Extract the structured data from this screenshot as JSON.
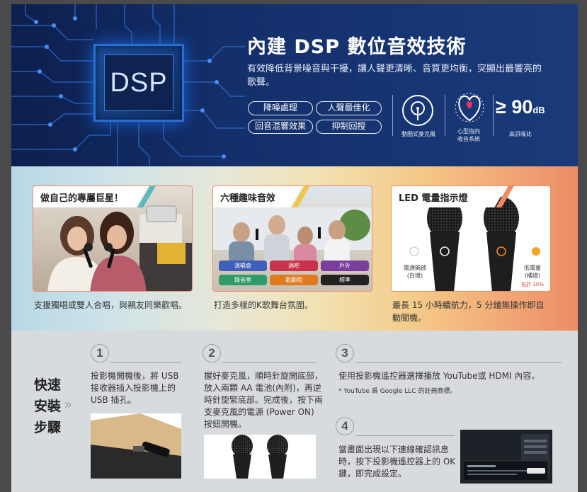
{
  "hero": {
    "chip_text": "DSP",
    "title": "內建 DSP 數位音效技術",
    "desc": "有效降低背景噪音與干擾，讓人聲更清晰、音質更均衡，突顯出最響亮的歌聲。",
    "pills": [
      "降噪處理",
      "人聲最佳化",
      "回音混響效果",
      "抑制回授"
    ],
    "features": [
      {
        "icon": "dynamic-mic-icon",
        "label": "動圈式麥克風"
      },
      {
        "icon": "cardioid-pattern-icon",
        "label": "心型指向\n收音系統"
      },
      {
        "value": "≥ 90",
        "unit": "dB",
        "label": "高訊噪比"
      }
    ]
  },
  "strip": {
    "cards": [
      {
        "title": "做自己的專屬巨星！",
        "caption": "支援獨唱或雙人合唱，與親友同樂歡唱。"
      },
      {
        "title": "六種趣味音效",
        "caption": "打造多樣的K歌舞台氛圍。",
        "effects": [
          {
            "label": "演唱會",
            "color": "#3f5fb8"
          },
          {
            "label": "酒吧",
            "color": "#c8314a"
          },
          {
            "label": "戶外",
            "color": "#7a3f9c"
          },
          {
            "label": "錄音室",
            "color": "#2f9a6a"
          },
          {
            "label": "歌劇院",
            "color": "#e07a1f"
          },
          {
            "label": "標準",
            "color": "#222222"
          }
        ]
      },
      {
        "title": "LED 電量指示燈",
        "caption": "最長 15 小時續航力，5 分鐘無操作即自動關機。",
        "led_left": "電源開啟\n(白燈)",
        "led_right": "低電量\n(橘燈)",
        "led_right_note": "低於 10%"
      }
    ]
  },
  "setup": {
    "title_lines": [
      "快速",
      "安裝",
      "步驟"
    ],
    "steps": [
      {
        "num": "1",
        "text": "投影機開機後，將 USB 接收器插入投影機上的 USB 插孔。"
      },
      {
        "num": "2",
        "text": "握好麥克風，順時針旋開底部，放入兩顆 AA 電池(內附)，再逆時針旋緊底部。完成後，按下兩支麥克風的電源 (Power ON) 按鈕開機。"
      },
      {
        "num": "3",
        "text": "使用投影機遙控器選擇播放 YouTube或 HDMI 內容。",
        "note": "* YouTube 爲 Google LLC 的註冊商標。"
      },
      {
        "num": "4",
        "text": "當畫面出現以下連線確認訊息時，按下投影機遙控器上的 OK 鍵，即完成設定。"
      }
    ]
  }
}
